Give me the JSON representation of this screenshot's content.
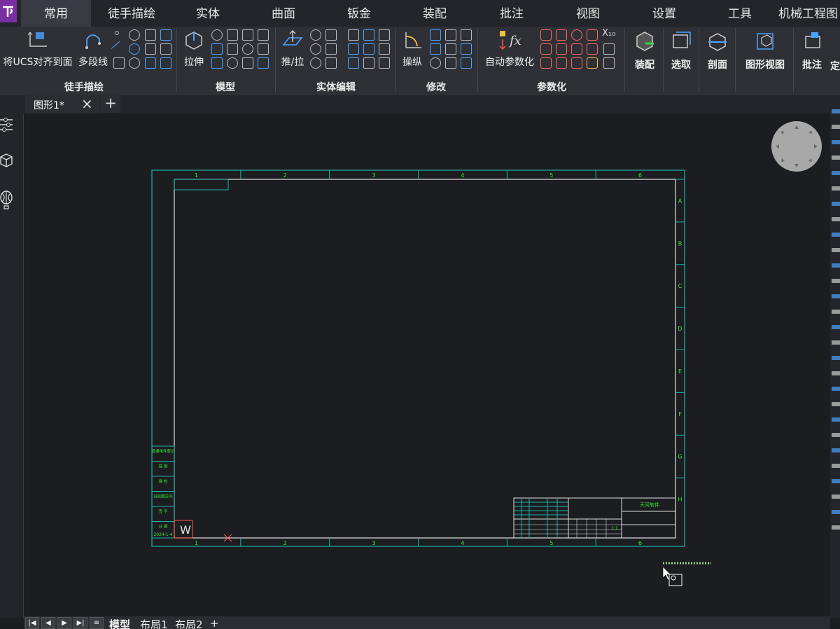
{
  "menu_tabs": [
    "常用",
    "徒手描绘",
    "实体",
    "曲面",
    "钣金",
    "装配",
    "批注",
    "视图",
    "设置",
    "工具",
    "机械工程图"
  ],
  "ribbon": {
    "big_buttons": {
      "align_ucs": "将UCS对齐到面",
      "polyline": "多段线",
      "extrude": "拉伸",
      "push_pull": "推/拉",
      "manipulate": "操纵",
      "auto_param": "自动参数化",
      "assembly": "装配",
      "select": "选取",
      "section": "剖面",
      "drawing_view": "图形视图",
      "annotate": "批注",
      "more": "定"
    },
    "groups": [
      "徒手描绘",
      "模型",
      "实体编辑",
      "修改",
      "参数化"
    ],
    "x10_label": "X₁₀"
  },
  "document": {
    "tab_name": "图形1*"
  },
  "drawing": {
    "col_labels": [
      "1",
      "2",
      "3",
      "4",
      "5",
      "6"
    ],
    "row_labels": [
      "A",
      "B",
      "C",
      "D",
      "E",
      "F",
      "G",
      "H"
    ],
    "title_block_name": "天河软件",
    "left_table": [
      "借通用件登记",
      "描  图",
      "描  校",
      "旧底图总号",
      "签  字",
      "日  期"
    ],
    "date_value": "2024-1-4",
    "marker_letter": "W",
    "scale": "1:1"
  },
  "layout_tabs": {
    "model": "模型",
    "layout1": "布局1",
    "layout2": "布局2",
    "add": "+"
  },
  "colors": {
    "accent_purple": "#7a2fa0",
    "border_cyan": "#1bb3a8",
    "paper_line": "#e0e0e0",
    "green_text": "#37e637"
  }
}
